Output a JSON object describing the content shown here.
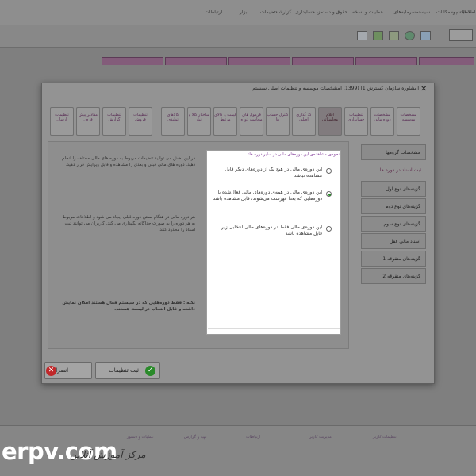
{
  "background": {
    "menu_items": [
      "ارتباطات",
      "ابزار",
      "تنظیمات",
      "گزارشات",
      "حسابداری",
      "حقوق و دستمزد",
      "عملیات و نسخه",
      "سرمایه‌های",
      "سیستم",
      "عملیات و امکانات",
      "اطلاعات پایه"
    ],
    "bottom_items": [
      "عملیات و دستور",
      "تهیه و گزارش",
      "ارتباطات",
      "مدیریت کاربر",
      "تنظیمات کاربر"
    ],
    "watermark": "erpv.com",
    "signature": "مرکز آموزش آنلاین"
  },
  "dialog": {
    "title": "[مشاوره سازمان گسترش 1] (1399) [مشخصات موسسه و تنظیمات اصلی سیستم]",
    "close": "✕",
    "tabs": [
      "مشخصات موسسه",
      "مشخصات دوره مالی",
      "تنظیمات حسابداری",
      "اقلام محاسباتی",
      "کد گذاری اصلی",
      "کنترل حساب ها",
      "فرمول های محاسبه دوره",
      "قیمت و کالای مرتبط",
      "ساختار کالا و انبار",
      "کالاهای تولیدی",
      "تنظیمات فروش",
      "تنظیمات گزارش",
      "مقادیر پیش فرض",
      "تنظیمات ارسال"
    ],
    "side_items": [
      "مشخصات گروهها",
      "ثبت اسناد در دوره ها",
      "گزینه‌های نوع اول",
      "گزینه‌های نوع دوم",
      "گزینه‌های نوع سوم",
      "اسناد مالی قفل",
      "گزینه‌های متفرقه 1",
      "گزینه‌های متفرقه 2"
    ],
    "left_paragraphs": [
      "در این بخش می توانید تنظیمات مربوط به دوره های مالی مختلف را انجام دهید. دوره های مالی قبلی و بعدی را مشاهده و قابل ویرایش قرار دهید.",
      "هر دوره مالی در هنگام بستن دوره قبلی ایجاد می شود و اطلاعات مربوط به هر دوره را به صورت جداگانه نگهداری می کند. کاربران می توانند ثبت اسناد را محدود کنند.",
      "نکته : فقط دوره‌هایی که در سیستم فعال هستند امکان نمایش داشته و قابل انتخاب در لیست هستند."
    ],
    "save_button": "ثبت تنظیمات",
    "cancel_button": "انصراف"
  },
  "popup": {
    "heading": "نحوه‌ی مشاهده‌ی این دوره‌های مالی در سایر دوره ها:",
    "options": [
      {
        "label": "این دوره‌ی مالی در هیچ یک از دوره‌های دیگر قابل مشاهده نباشد",
        "checked": false
      },
      {
        "label": "این دوره‌ی مالی در همه‌ی دوره‌های مالی فعال‌شده یا دوره‌هایی که بعدا فهرست می‌شوند، قابل مشاهده باشد",
        "checked": true
      },
      {
        "label": "این دوره‌ی مالی فقط در دوره‌های مالی انتخابی زیر قابل مشاهده باشد",
        "checked": false
      }
    ]
  },
  "colors": {
    "accent": "#7a2e93",
    "tab_text": "#5a2e56",
    "check": "#2a8a2a",
    "cancel": "#c0282a"
  }
}
